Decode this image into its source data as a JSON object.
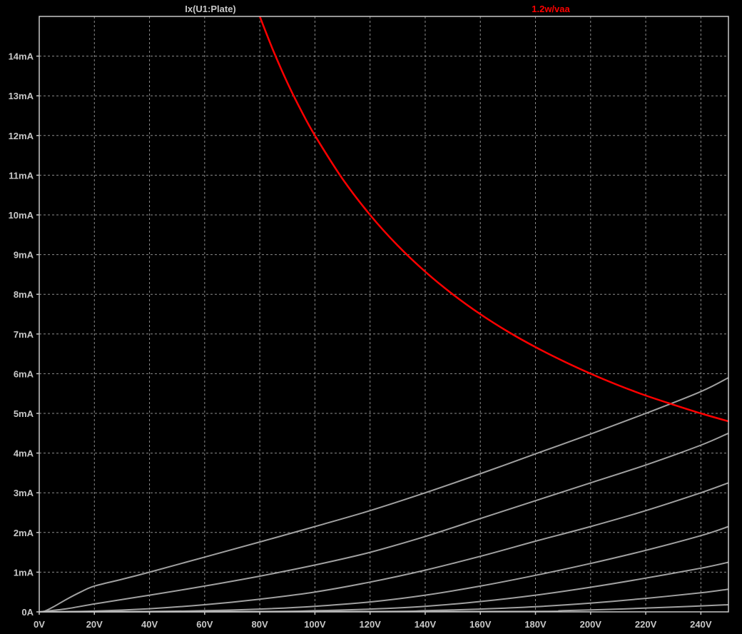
{
  "chart_data": {
    "type": "line",
    "title": "",
    "xlabel": "",
    "ylabel": "",
    "xlim": [
      0,
      250
    ],
    "ylim": [
      0,
      15
    ],
    "grid": true,
    "background": "#000000",
    "x_ticks": [
      0,
      20,
      40,
      60,
      80,
      100,
      120,
      140,
      160,
      180,
      200,
      220,
      240
    ],
    "x_tick_labels": [
      "0V",
      "20V",
      "40V",
      "60V",
      "80V",
      "100V",
      "120V",
      "140V",
      "160V",
      "180V",
      "200V",
      "220V",
      "240V"
    ],
    "y_ticks": [
      0,
      1,
      2,
      3,
      4,
      5,
      6,
      7,
      8,
      9,
      10,
      11,
      12,
      13,
      14
    ],
    "y_tick_labels": [
      "0A",
      "1mA",
      "2mA",
      "3mA",
      "4mA",
      "5mA",
      "6mA",
      "7mA",
      "8mA",
      "9mA",
      "10mA",
      "11mA",
      "12mA",
      "13mA",
      "14mA"
    ],
    "legend": [
      {
        "label": "Ix(U1:Plate)",
        "color": "#c8c8c8"
      },
      {
        "label": "1.2w/vaa",
        "color": "#ff0000"
      }
    ],
    "series": [
      {
        "name": "Ix(U1:Plate)",
        "color": "#a0a0a0",
        "x": [
          0,
          2,
          5,
          10,
          15,
          20,
          30,
          40,
          60,
          80,
          100,
          120,
          140,
          160,
          180,
          200,
          220,
          240,
          250
        ],
        "y": [
          0,
          0.02,
          0.12,
          0.32,
          0.5,
          0.65,
          0.82,
          1.0,
          1.38,
          1.76,
          2.15,
          2.55,
          3.0,
          3.48,
          3.98,
          4.48,
          5.0,
          5.55,
          5.9
        ]
      },
      {
        "color": "#a0a0a0",
        "x": [
          0,
          10,
          20,
          40,
          60,
          80,
          100,
          120,
          140,
          160,
          180,
          200,
          220,
          240,
          250
        ],
        "y": [
          0,
          0.08,
          0.2,
          0.42,
          0.65,
          0.9,
          1.18,
          1.5,
          1.9,
          2.35,
          2.8,
          3.25,
          3.7,
          4.2,
          4.5
        ]
      },
      {
        "color": "#a0a0a0",
        "x": [
          0,
          20,
          40,
          60,
          80,
          100,
          120,
          140,
          160,
          180,
          200,
          220,
          240,
          250
        ],
        "y": [
          0,
          0.02,
          0.08,
          0.18,
          0.32,
          0.5,
          0.75,
          1.05,
          1.4,
          1.78,
          2.15,
          2.55,
          3.0,
          3.25
        ]
      },
      {
        "color": "#a0a0a0",
        "x": [
          0,
          40,
          60,
          80,
          100,
          120,
          140,
          160,
          180,
          200,
          220,
          240,
          250
        ],
        "y": [
          0,
          0.01,
          0.03,
          0.07,
          0.14,
          0.25,
          0.42,
          0.65,
          0.92,
          1.22,
          1.55,
          1.92,
          2.15
        ]
      },
      {
        "color": "#a0a0a0",
        "x": [
          0,
          80,
          100,
          120,
          140,
          160,
          180,
          200,
          220,
          240,
          250
        ],
        "y": [
          0,
          0.01,
          0.03,
          0.07,
          0.14,
          0.26,
          0.42,
          0.62,
          0.85,
          1.1,
          1.25
        ]
      },
      {
        "color": "#a0a0a0",
        "x": [
          0,
          120,
          140,
          160,
          180,
          200,
          220,
          240,
          250
        ],
        "y": [
          0,
          0.01,
          0.03,
          0.07,
          0.13,
          0.22,
          0.34,
          0.48,
          0.57
        ]
      },
      {
        "color": "#a0a0a0",
        "x": [
          0,
          170,
          190,
          210,
          230,
          250
        ],
        "y": [
          0,
          0.01,
          0.03,
          0.07,
          0.12,
          0.18
        ]
      },
      {
        "name": "1.2w/vaa",
        "color": "#ff0000",
        "formula": "1200/x mA",
        "x": [
          80,
          85,
          90,
          95,
          100,
          110,
          120,
          130,
          140,
          150,
          160,
          170,
          180,
          190,
          200,
          210,
          220,
          230,
          240,
          250
        ],
        "y": [
          15,
          14.12,
          13.33,
          12.63,
          12,
          10.91,
          10,
          9.23,
          8.57,
          8,
          7.5,
          7.06,
          6.67,
          6.32,
          6,
          5.71,
          5.45,
          5.22,
          5,
          4.8
        ]
      }
    ]
  }
}
